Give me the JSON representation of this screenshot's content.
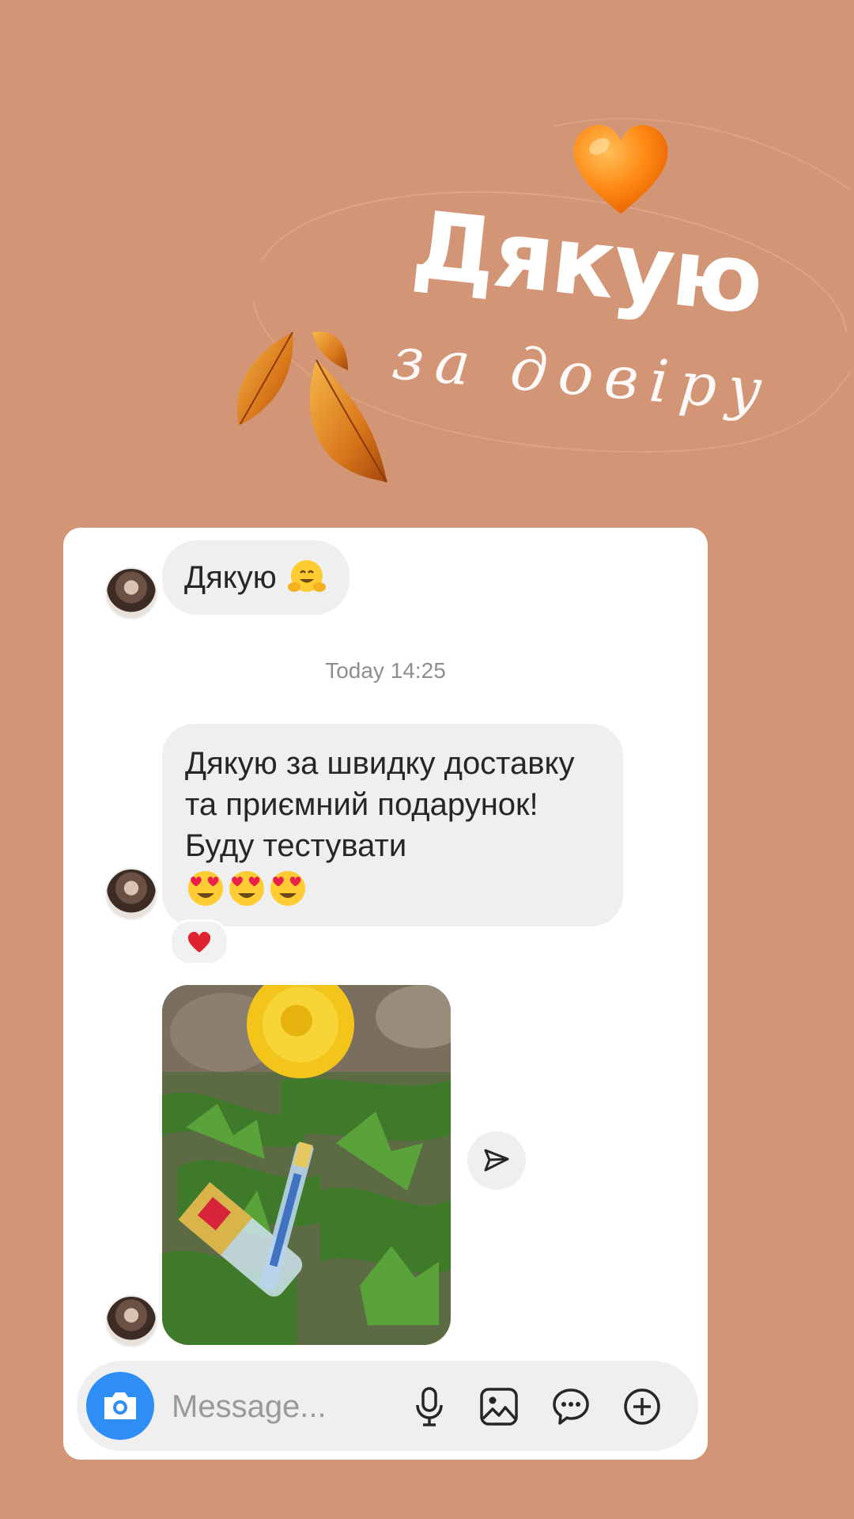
{
  "story": {
    "title": "Дякую",
    "subtitle": "за довіру"
  },
  "chat": {
    "messages": [
      {
        "text": "Дякую",
        "emoji": "hugging-face"
      },
      {
        "text": "Дякую за швидку доставку та приємний подарунок!  Буду тестувати",
        "emoji": "smiling-face-with-heart-eyes x3",
        "reaction": "red-heart"
      },
      {
        "type": "photo",
        "description_icon": "dandelion-and-perfume-bottles-photo"
      }
    ],
    "timestamp": "Today 14:25",
    "composer": {
      "placeholder": "Message..."
    }
  },
  "colors": {
    "background": "#d29676",
    "card": "#ffffff",
    "bubble": "#efefef",
    "accent": "#2f8ef5",
    "heart": "#f57c00"
  }
}
